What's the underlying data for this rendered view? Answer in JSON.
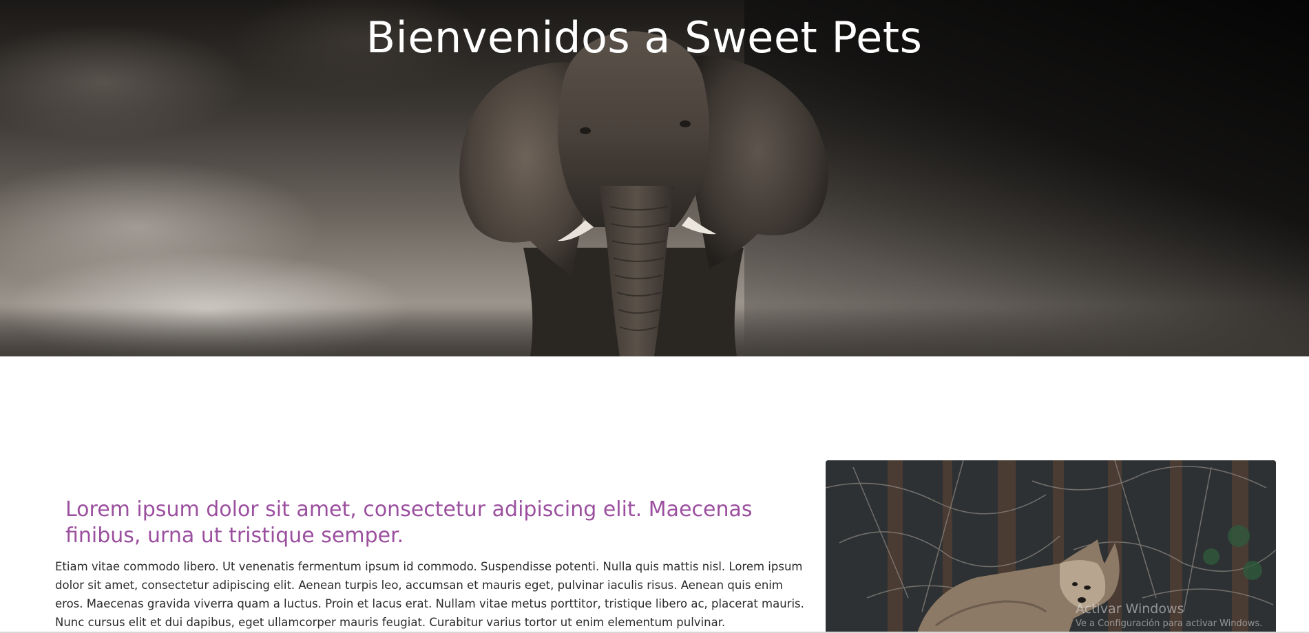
{
  "hero": {
    "title": "Bienvenidos a Sweet Pets",
    "image": "elephant-photo"
  },
  "article": {
    "heading": "Lorem ipsum dolor sit amet, consectetur adipiscing elit. Maecenas finibus, urna ut tristique semper.",
    "body": "Etiam vitae commodo libero. Ut venenatis fermentum ipsum id commodo. Suspendisse potenti. Nulla quis mattis nisl. Lorem ipsum dolor sit amet, consectetur adipiscing elit. Aenean turpis leo, accumsan et mauris eget, pulvinar iaculis risus. Aenean quis enim eros. Maecenas gravida viverra quam a luctus. Proin et lacus erat. Nullam vitae metus porttitor, tristique libero ac, placerat mauris. Nunc cursus elit et dui dapibus, eget ullamcorper mauris feugiat. Curabitur varius tortor ut enim elementum pulvinar."
  },
  "card": {
    "image": "coyote-photo"
  },
  "watermark": {
    "title": "Activar Windows",
    "subtitle": "Ve a Configuración para activar Windows."
  },
  "colors": {
    "heading_accent": "#9b4f9f",
    "body_text": "#2a2a2a",
    "hero_title": "#ffffff"
  }
}
